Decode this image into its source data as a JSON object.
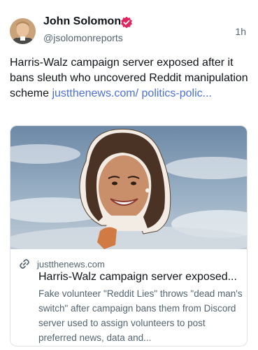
{
  "post": {
    "author_name": "John Solomon",
    "author_handle": "@jsolomonreports",
    "timestamp": "1h",
    "verified_color": "#e0245e",
    "text": "Harris-Walz campaign server exposed after it bans sleuth who uncovered Reddit manipulation scheme ",
    "link_text": "justthenews.com/ politics-polic..."
  },
  "card": {
    "domain": "justthenews.com",
    "title": "Harris-Walz campaign server exposed...",
    "description": "Fake volunteer \"Reddit Lies\" throws \"dead man's switch\" after campaign bans them from Discord server used to assign volunteers to post preferred news, data and..."
  },
  "colors": {
    "link": "#4c6edb",
    "secondary_text": "#536471"
  }
}
